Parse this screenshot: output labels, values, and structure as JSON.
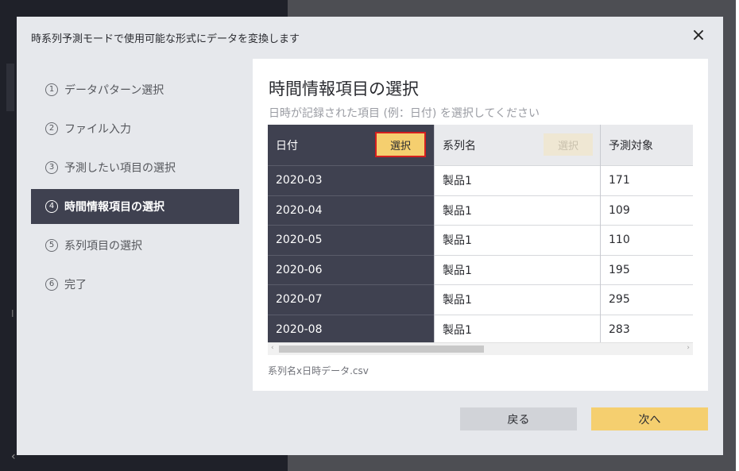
{
  "dialog": {
    "title": "時系列予測モードで使用可能な形式にデータを変換します",
    "close_icon": "×"
  },
  "background": {
    "letter": "I",
    "arrow": "‹"
  },
  "steps": [
    {
      "num": "1",
      "label": "データパターン選択",
      "active": false
    },
    {
      "num": "2",
      "label": "ファイル入力",
      "active": false
    },
    {
      "num": "3",
      "label": "予測したい項目の選択",
      "active": false
    },
    {
      "num": "4",
      "label": "時間情報項目の選択",
      "active": true
    },
    {
      "num": "5",
      "label": "系列項目の選択",
      "active": false
    },
    {
      "num": "6",
      "label": "完了",
      "active": false
    }
  ],
  "panel": {
    "title": "時間情報項目の選択",
    "subtitle": "日時が記録された項目 (例：日付) を選択してください",
    "filename": "系列名x日時データ.csv"
  },
  "table": {
    "columns": [
      {
        "header": "日付",
        "select_label": "選択"
      },
      {
        "header": "系列名",
        "select_label": "選択"
      },
      {
        "header": "予測対象"
      }
    ],
    "rows": [
      [
        "2020-03",
        "製品1",
        "171"
      ],
      [
        "2020-04",
        "製品1",
        "109"
      ],
      [
        "2020-05",
        "製品1",
        "110"
      ],
      [
        "2020-06",
        "製品1",
        "195"
      ],
      [
        "2020-07",
        "製品1",
        "295"
      ],
      [
        "2020-08",
        "製品1",
        "283"
      ]
    ]
  },
  "scrollbar": {
    "left_arrow": "‹",
    "right_arrow": "›"
  },
  "buttons": {
    "back": "戻る",
    "next": "次へ"
  },
  "colors": {
    "accent": "#f5cf6f",
    "highlight_border": "#d31f1f",
    "active_step": "#3f4150"
  }
}
